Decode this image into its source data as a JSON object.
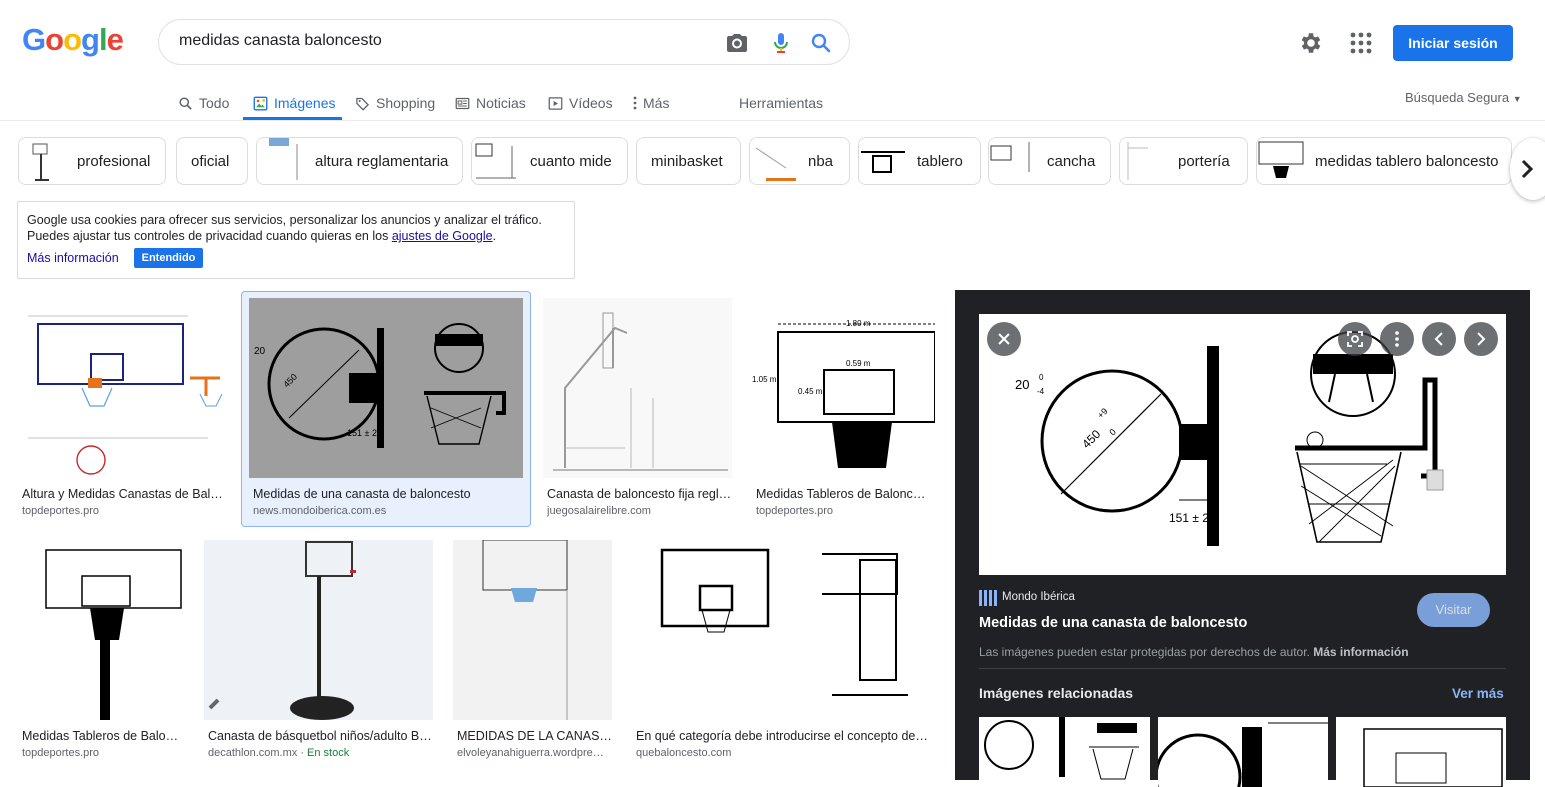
{
  "header": {
    "logo": [
      "G",
      "o",
      "o",
      "g",
      "l",
      "e"
    ],
    "logo_colors": [
      "#4285F4",
      "#EA4335",
      "#FBBC05",
      "#4285F4",
      "#34A853",
      "#EA4335"
    ],
    "query": "medidas canasta baloncesto",
    "signin_label": "Iniciar sesión"
  },
  "tabs": [
    {
      "label": "Todo",
      "icon": "search-icon"
    },
    {
      "label": "Imágenes",
      "icon": "image-icon",
      "active": true
    },
    {
      "label": "Shopping",
      "icon": "tag-icon"
    },
    {
      "label": "Noticias",
      "icon": "news-icon"
    },
    {
      "label": "Vídeos",
      "icon": "play-icon"
    },
    {
      "label": "Más",
      "icon": "more-vert-icon"
    }
  ],
  "tools_label": "Herramientas",
  "safe_search": "Búsqueda Segura",
  "chips": [
    "profesional",
    "oficial",
    "altura reglamentaria",
    "cuanto mide",
    "minibasket",
    "nba",
    "tablero",
    "cancha",
    "portería",
    "medidas tablero baloncesto"
  ],
  "cookie": {
    "line1": "Google usa cookies para ofrecer sus servicios, personalizar los anuncios y analizar el tráfico.",
    "line2_prefix": "Puedes ajustar tus controles de privacidad cuando quieras en los ",
    "line2_link": "ajustes de Google",
    "line2_suffix": ".",
    "more": "Más información",
    "ok": "Entendido"
  },
  "results": [
    {
      "title": "Altura y Medidas Canastas de Balo…",
      "source": "topdeportes.pro"
    },
    {
      "title": "Medidas de una canasta de baloncesto",
      "source": "news.mondoiberica.com.es"
    },
    {
      "title": "Canasta de baloncesto fija regl…",
      "source": "juegosalairelibre.com"
    },
    {
      "title": "Medidas Tableros de Balonce…",
      "source": "topdeportes.pro"
    },
    {
      "title": "Medidas Tableros de Balon…",
      "source": "topdeportes.pro"
    },
    {
      "title": "Canasta de básquetbol niños/adulto B…",
      "source": "decathlon.com.mx",
      "extra": "En stock"
    },
    {
      "title": "MEDIDAS DE LA CANAST…",
      "source": "elvoleyanahiguerra.wordpre…"
    },
    {
      "title": "En qué categoría debe introducirse el concepto de \"…",
      "source": "quebaloncesto.com"
    }
  ],
  "viewer": {
    "source": "Mondo Ibérica",
    "title": "Medidas de una canasta de baloncesto",
    "visit": "Visitar",
    "copyright": "Las imágenes pueden estar protegidas por derechos de autor.",
    "copyright_link": "Más información",
    "related": "Imágenes relacionadas",
    "see_more": "Ver más"
  },
  "diagram_labels": {
    "radius": "20",
    "radius_sup": "0",
    "radius_sub": "-4",
    "diameter": "450",
    "diameter_sup": "+9",
    "diameter_sub": "0",
    "offset": "151 ± 2",
    "board_width": "1.80 m",
    "rim_width": "0.59 m",
    "board_height": "1.05 m",
    "rim_height": "0.45 m"
  },
  "colors": {
    "accent": "#1a73e8",
    "viewer_bg": "#202124",
    "link": "#1a0dab",
    "stock": "#188038"
  }
}
